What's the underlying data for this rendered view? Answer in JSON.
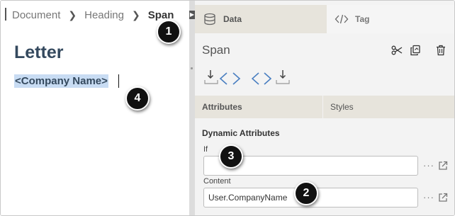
{
  "breadcrumb": {
    "items": [
      "Document",
      "Heading",
      "Span"
    ]
  },
  "editor": {
    "title": "Letter",
    "selected_text": "<Company Name>"
  },
  "panel": {
    "tabs": [
      {
        "label": "Data",
        "icon": "database-icon"
      },
      {
        "label": "Tag",
        "icon": "code-icon"
      }
    ],
    "element_name": "Span",
    "toolbar_icons": [
      "cut-icon",
      "copy-icon",
      "delete-icon"
    ],
    "wrap_buttons": [
      "wrap-before-icon",
      "wrap-after-icon"
    ],
    "sub_tabs": [
      "Attributes",
      "Styles"
    ],
    "section_title": "Dynamic Attributes",
    "fields": [
      {
        "label": "If",
        "value": ""
      },
      {
        "label": "Content",
        "value": "User.CompanyName"
      }
    ],
    "more_label": "···"
  },
  "callouts": [
    "1",
    "2",
    "3",
    "4"
  ],
  "colors": {
    "accent": "#4a7fc1",
    "heading": "#34495e",
    "selection": "#c8dcf3",
    "tab_active": "#e7e4dc"
  }
}
